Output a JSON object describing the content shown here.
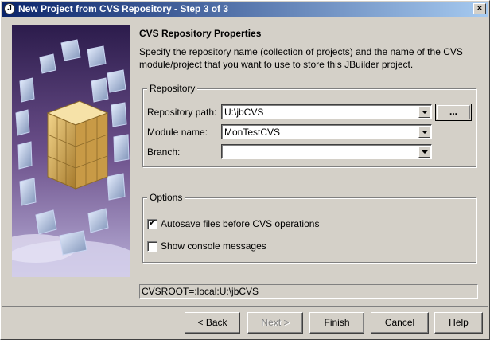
{
  "window": {
    "title": "New Project from CVS Repository - Step 3 of 3",
    "icon": "jbuilder-icon",
    "close_glyph": "×"
  },
  "main": {
    "heading": "CVS Repository Properties",
    "description": "Specify the repository name (collection of projects) and the name of the CVS module/project that you want to use to store this JBuilder project."
  },
  "repository": {
    "legend": "Repository",
    "path_label": "Repository path:",
    "path_value": "U:\\jbCVS",
    "browse_label": "...",
    "module_label": "Module name:",
    "module_value": "MonTestCVS",
    "branch_label": "Branch:",
    "branch_value": ""
  },
  "options": {
    "legend": "Options",
    "autosave_label": "Autosave files before CVS operations",
    "autosave_checked": true,
    "console_label": "Show console messages",
    "console_checked": false,
    "check_glyph": "✔"
  },
  "status": {
    "cvsroot": "CVSROOT=:local:U:\\jbCVS"
  },
  "buttons": {
    "back": "< Back",
    "next": "Next >",
    "finish": "Finish",
    "cancel": "Cancel",
    "help": "Help"
  }
}
